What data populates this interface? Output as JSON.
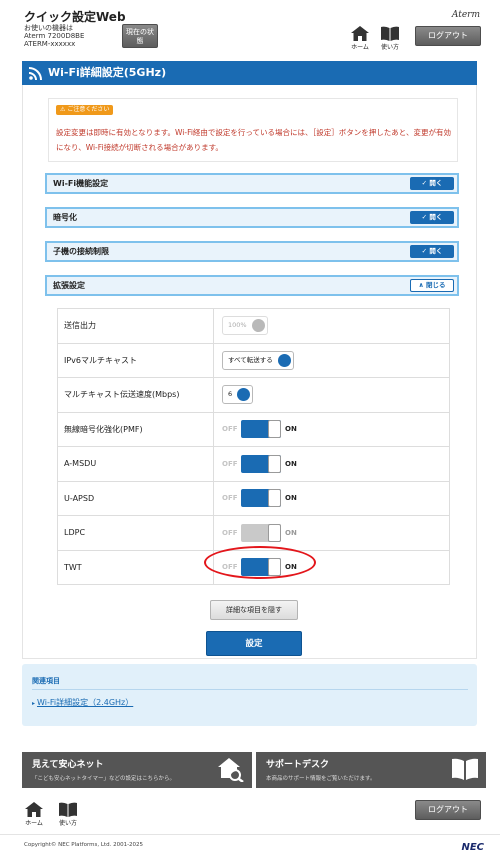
{
  "header": {
    "title": "クイック設定Web",
    "device_label": "お使いの機器は",
    "model": "Aterm 7200D8BE",
    "device_name": "ATERM-xxxxxx",
    "status_button": "現在の状態",
    "home_label": "ホーム",
    "help_label": "使い方",
    "brand": "Aterm",
    "logout_label": "ログアウト"
  },
  "section": {
    "title": "Wi-Fi詳細設定(5GHz)"
  },
  "caution": {
    "tag": "ご注意ください",
    "message": "設定変更は即時に有効となります。Wi-Fi経由で設定を行っている場合には、［設定］ボタンを押したあと、変更が有効になり、Wi-Fi接続が切断される場合があります。"
  },
  "accordion": [
    {
      "label": "Wi-Fi機能設定",
      "toggle": "開く",
      "state": "closed"
    },
    {
      "label": "暗号化",
      "toggle": "開く",
      "state": "closed"
    },
    {
      "label": "子機の接続制限",
      "toggle": "開く",
      "state": "closed"
    },
    {
      "label": "拡張設定",
      "toggle": "閉じる",
      "state": "open"
    }
  ],
  "settings": {
    "tx_power": {
      "label": "送信出力",
      "value": "100%",
      "disabled": true
    },
    "ipv6_multicast": {
      "label": "IPv6マルチキャスト",
      "value": "すべて転送する"
    },
    "multicast_rate": {
      "label": "マルチキャスト伝送速度(Mbps)",
      "value": "6"
    },
    "pmf": {
      "label": "無線暗号化強化(PMF)",
      "off": "OFF",
      "on": "ON",
      "state": "on"
    },
    "amsdu": {
      "label": "A-MSDU",
      "off": "OFF",
      "on": "ON",
      "state": "on"
    },
    "uapsd": {
      "label": "U-APSD",
      "off": "OFF",
      "on": "ON",
      "state": "on"
    },
    "ldpc": {
      "label": "LDPC",
      "off": "OFF",
      "on": "ON",
      "state": "disabled"
    },
    "twt": {
      "label": "TWT",
      "off": "OFF",
      "on": "ON",
      "state": "on"
    }
  },
  "buttons": {
    "hide_details": "詳細な項目を隠す",
    "apply": "設定"
  },
  "related": {
    "title": "関連項目",
    "link": "Wi-Fi詳細設定（2.4GHz）"
  },
  "promo": [
    {
      "title": "見えて安心ネット",
      "desc": "「こども安心ネットタイマー」などの設定はこちらから。"
    },
    {
      "title": "サポートデスク",
      "desc": "本商品のサポート情報をご覧いただけます。"
    }
  ],
  "footer": {
    "home_label": "ホーム",
    "help_label": "使い方",
    "logout_label": "ログアウト",
    "copyright": "Copyright© NEC Platforms, Ltd. 2001-2025",
    "brand": "NEC"
  },
  "colors": {
    "primary": "#1a6bb3",
    "caution": "#c0392b",
    "accent_orange": "#f0991a",
    "highlight": "#e3161b"
  }
}
